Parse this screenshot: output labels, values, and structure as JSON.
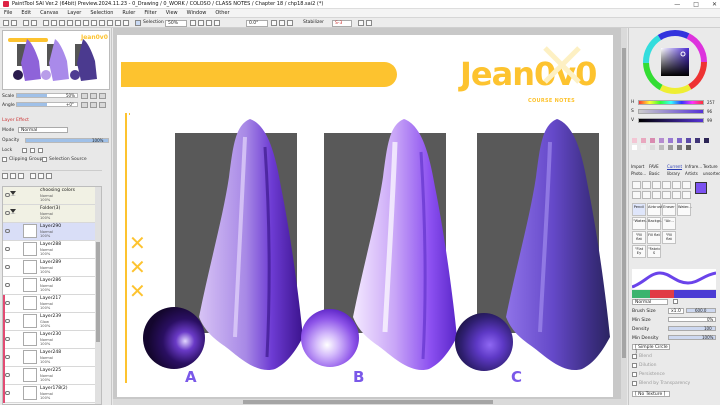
{
  "window": {
    "title": "PaintTool SAI Ver.2 (64bit) Preview.2024.11.23 - 0_Drawing / 0_WORK / COLOSO / CLASS NOTES / Chapter 18 / chp18.sai2 (*)",
    "min_glyph": "—",
    "max_glyph": "□",
    "close_glyph": "✕"
  },
  "menu": {
    "items": [
      "File",
      "Edit",
      "Canvas",
      "Layer",
      "Selection",
      "Ruler",
      "Filter",
      "View",
      "Window",
      "Other"
    ]
  },
  "toolbar": {
    "selection_label": "Selection",
    "zoom_value": "50%",
    "angle_value": "0.0°",
    "stabilizer_label": "Stabilizer",
    "stabilizer_value": "S-3"
  },
  "navigator": {
    "scale_label": "Scale",
    "scale_value": "50%",
    "scale_fraction": 0.5,
    "angle_label": "Angle",
    "angle_value": "+0°",
    "angle_fraction": 0.5,
    "thumb_brand": "Jean0v0"
  },
  "layer_effect": {
    "header": "Layer Effect",
    "mode_label": "Mode",
    "mode_value": "Normal",
    "opacity_label": "Opacity",
    "opacity_value": "100%",
    "opacity_fraction": 1.0,
    "lock_label": "Lock",
    "clipping_group_label": "Clipping Group",
    "selection_source_label": "Selection Source"
  },
  "layers": [
    {
      "name": "choosing colors",
      "mode": "Normal",
      "opacity": "100%",
      "type": "folder"
    },
    {
      "name": "Folder(3)",
      "mode": "Normal",
      "opacity": "100%",
      "type": "folder"
    },
    {
      "name": "Layer290",
      "mode": "Normal",
      "opacity": "100%",
      "type": "selected"
    },
    {
      "name": "Layer288",
      "mode": "Normal",
      "opacity": "100%",
      "type": "layer"
    },
    {
      "name": "Layer289",
      "mode": "Normal",
      "opacity": "100%",
      "type": "layer"
    },
    {
      "name": "Layer286",
      "mode": "Normal",
      "opacity": "100%",
      "type": "layer"
    },
    {
      "name": "Layer217",
      "mode": "Normal",
      "opacity": "100%",
      "type": "layer"
    },
    {
      "name": "Layer239",
      "mode": "Glow",
      "opacity": "100%",
      "type": "layer"
    },
    {
      "name": "Layer230",
      "mode": "Normal",
      "opacity": "100%",
      "type": "layer"
    },
    {
      "name": "Layer248",
      "mode": "Normal",
      "opacity": "100%",
      "type": "layer"
    },
    {
      "name": "Layer225",
      "mode": "Normal",
      "opacity": "100%",
      "type": "layer"
    },
    {
      "name": "Layer178(2)",
      "mode": "Normal",
      "opacity": "100%",
      "type": "layer"
    }
  ],
  "canvas": {
    "brand": "Jean0v0",
    "subtitle": "COURSE NOTES",
    "labels": [
      "A",
      "B",
      "C"
    ],
    "accent_color": "#fdc32f",
    "label_color": "#7a58e9"
  },
  "color_panel": {
    "values": [
      "257",
      "96",
      "99"
    ]
  },
  "tabs_row1": [
    "Import",
    "FAVE",
    "Current",
    "Infrare...",
    "Texture"
  ],
  "tabs_row2": [
    "Photo...",
    "Basic",
    "library",
    "Artists",
    "unsorted"
  ],
  "brushes": [
    "Pencil",
    "Airbrush",
    "Eraser",
    "Water..."
  ],
  "brush_sub": [
    "\"Water...",
    "Backgr...",
    "\"Air..."
  ],
  "brush_sub2": [
    "\"Fill flat",
    "Fill flat",
    "\"Fill flat"
  ],
  "brush_sub3": [
    "\"Flat Ey",
    "\"Fabric S"
  ],
  "blend": {
    "mode_value": "Normal"
  },
  "brush_props": {
    "size_label": "Brush Size",
    "size_mult": "x1.0",
    "size_value": "600.0",
    "min_size_label": "Min Size",
    "min_size_value": "0%",
    "density_label": "Density",
    "density_value": "100",
    "min_density_label": "Min Density",
    "min_density_value": "100%",
    "simple_circle": "[ Simple Circle ]",
    "blend_label": "Blend",
    "dilution_label": "Dilution",
    "persistence_label": "Persistence",
    "blend_transparency": "Blend by Transparency",
    "no_texture": "[ No Texture ]"
  }
}
